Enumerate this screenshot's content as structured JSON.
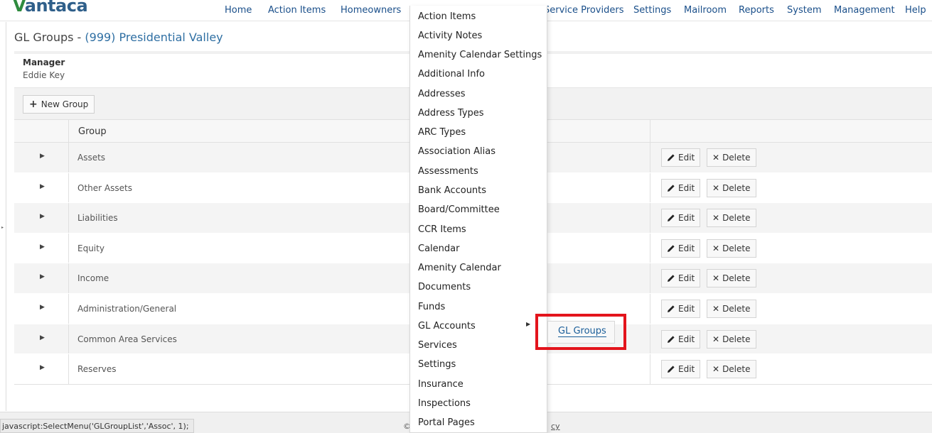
{
  "app": {
    "logo_prefix": "V",
    "logo_rest": "antaca"
  },
  "nav": [
    "Home",
    "Action Items",
    "Homeowners",
    "Service Providers",
    "Settings",
    "Mailroom",
    "Reports",
    "System",
    "Management",
    "Help"
  ],
  "page": {
    "title_prefix": "GL Groups - ",
    "association": "(999) Presidential Valley",
    "manager_label": "Manager",
    "manager_name": "Eddie Key"
  },
  "toolbar": {
    "new_group_label": "New Group"
  },
  "table": {
    "header_group": "Group",
    "edit_label": "Edit",
    "delete_label": "Delete",
    "rows": [
      "Assets",
      "Other Assets",
      "Liabilities",
      "Equity",
      "Income",
      "Administration/General",
      "Common Area Services",
      "Reserves"
    ]
  },
  "dropdown": {
    "items": [
      "Action Items",
      "Activity Notes",
      "Amenity Calendar Settings",
      "Additional Info",
      "Addresses",
      "Address Types",
      "ARC Types",
      "Association Alias",
      "Assessments",
      "Bank Accounts",
      "Board/Committee",
      "CCR Items",
      "Calendar",
      "Amenity Calendar",
      "Documents",
      "Funds",
      "GL Accounts",
      "Services",
      "Settings",
      "Insurance",
      "Inspections",
      "Portal Pages"
    ],
    "submenu_item": "GL Groups"
  },
  "footer": {
    "status_text": "javascript:SelectMenu('GLGroupList','Assoc', 1);",
    "copyright_fragment": "©",
    "policy_fragment": "cy"
  },
  "colors": {
    "highlight": "#e3141c",
    "link": "#1a4f8a",
    "logo_green": "#2e8b3e"
  }
}
